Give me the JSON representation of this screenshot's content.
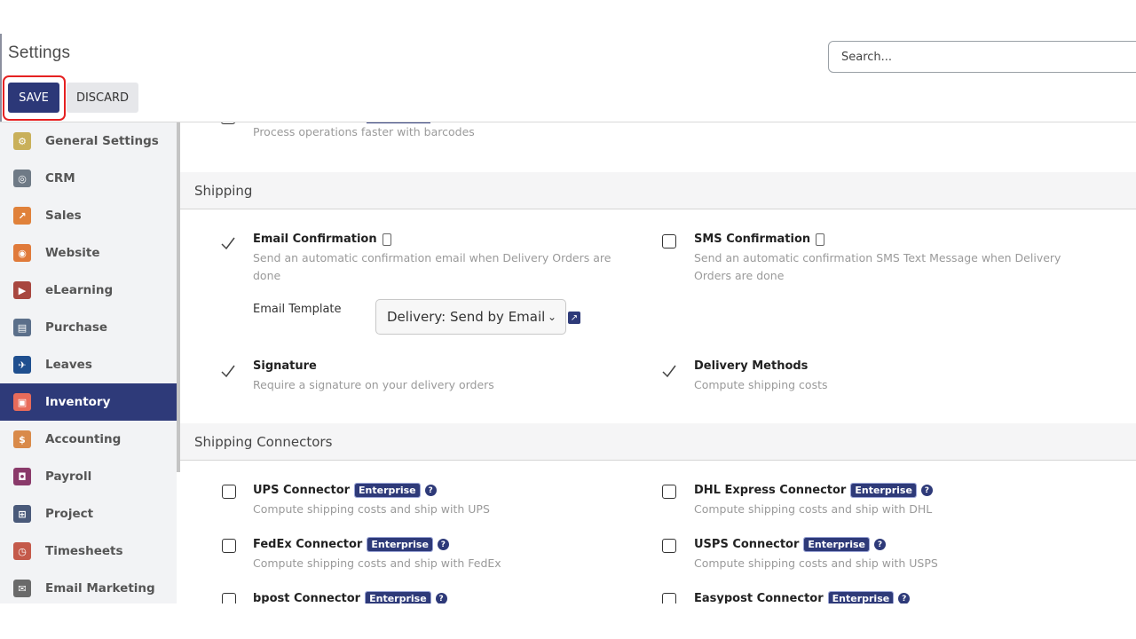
{
  "header": {
    "title": "Settings",
    "search_placeholder": "Search..."
  },
  "actions": {
    "save": "SAVE",
    "discard": "DISCARD"
  },
  "sidebar": {
    "active": "Inventory",
    "items": [
      {
        "label": "General Settings",
        "icon": "gear-icon",
        "color": "#c9b05a",
        "glyph": "⚙"
      },
      {
        "label": "CRM",
        "icon": "crm-icon",
        "color": "#6f7a86",
        "glyph": "◎"
      },
      {
        "label": "Sales",
        "icon": "sales-chart-icon",
        "color": "#e0813a",
        "glyph": "↗"
      },
      {
        "label": "Website",
        "icon": "website-icon",
        "color": "#e07a3a",
        "glyph": "◉"
      },
      {
        "label": "eLearning",
        "icon": "elearning-icon",
        "color": "#a8473f",
        "glyph": "▶"
      },
      {
        "label": "Purchase",
        "icon": "purchase-icon",
        "color": "#5b6f8a",
        "glyph": "▤"
      },
      {
        "label": "Leaves",
        "icon": "leaves-icon",
        "color": "#1f4f8f",
        "glyph": "✈"
      },
      {
        "label": "Inventory",
        "icon": "inventory-icon",
        "color": "#e86b5a",
        "glyph": "▣"
      },
      {
        "label": "Accounting",
        "icon": "accounting-icon",
        "color": "#d98a4a",
        "glyph": "$"
      },
      {
        "label": "Payroll",
        "icon": "payroll-icon",
        "color": "#8a3a6a",
        "glyph": "◘"
      },
      {
        "label": "Project",
        "icon": "project-icon",
        "color": "#4a5a7a",
        "glyph": "⊞"
      },
      {
        "label": "Timesheets",
        "icon": "timesheets-icon",
        "color": "#c45a4a",
        "glyph": "◷"
      },
      {
        "label": "Email Marketing",
        "icon": "email-marketing-icon",
        "color": "#6a6a6a",
        "glyph": "✉"
      }
    ]
  },
  "content": {
    "barcode_desc": "Process operations faster with barcodes",
    "shipping": {
      "title": "Shipping",
      "email_confirmation": {
        "name": "Email Confirmation",
        "desc": "Send an automatic confirmation email when Delivery Orders are done",
        "checked": true
      },
      "email_template_label": "Email Template",
      "email_template_value": "Delivery: Send by Email",
      "sms_confirmation": {
        "name": "SMS Confirmation",
        "desc": "Send an automatic confirmation SMS Text Message when Delivery Orders are done",
        "checked": false
      },
      "signature": {
        "name": "Signature",
        "desc": "Require a signature on your delivery orders",
        "checked": true
      },
      "delivery_methods": {
        "name": "Delivery Methods",
        "desc": "Compute shipping costs",
        "checked": true
      }
    },
    "connectors": {
      "title": "Shipping Connectors",
      "badge": "Enterprise",
      "ups": {
        "name": "UPS Connector",
        "desc": "Compute shipping costs and ship with UPS"
      },
      "dhl": {
        "name": "DHL Express Connector",
        "desc": "Compute shipping costs and ship with DHL"
      },
      "fedex": {
        "name": "FedEx Connector",
        "desc": "Compute shipping costs and ship with FedEx"
      },
      "usps": {
        "name": "USPS Connector",
        "desc": "Compute shipping costs and ship with USPS"
      },
      "bpost": {
        "name": "bpost Connector"
      },
      "easypost": {
        "name": "Easypost Connector"
      }
    }
  }
}
